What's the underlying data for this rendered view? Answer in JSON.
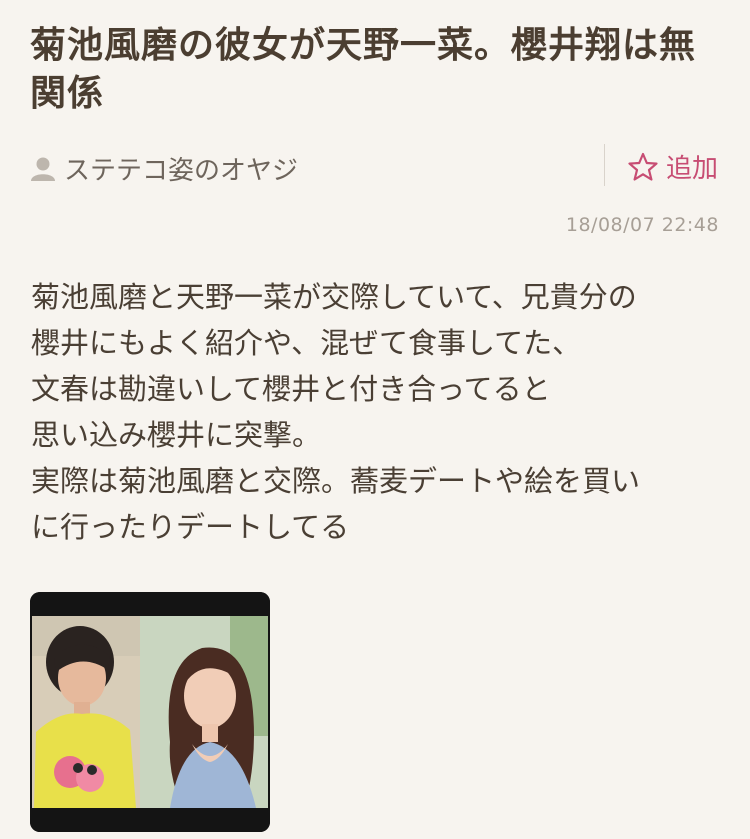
{
  "post": {
    "title": "菊池風磨の彼女が天野一菜。櫻井翔は無関係",
    "author": "ステテコ姿のオヤジ",
    "add_label": "追加",
    "timestamp": "18/08/07 22:48",
    "body": "菊池風磨と天野一菜が交際していて、兄貴分の\n櫻井にもよく紹介や、混ぜて食事してた、\n文春は勘違いして櫻井と付き合ってると\n思い込み櫻井に突撃。\n実際は菊池風磨と交際。蕎麦デートや絵を買い\nに行ったりデートしてる"
  },
  "icons": {
    "author_icon": "user-icon",
    "add_icon": "star-outline-icon"
  },
  "colors": {
    "background": "#f7f4ef",
    "title": "#4b3e31",
    "accent": "#c74d73",
    "meta_text": "#6e655c",
    "timestamp": "#a79f96"
  }
}
